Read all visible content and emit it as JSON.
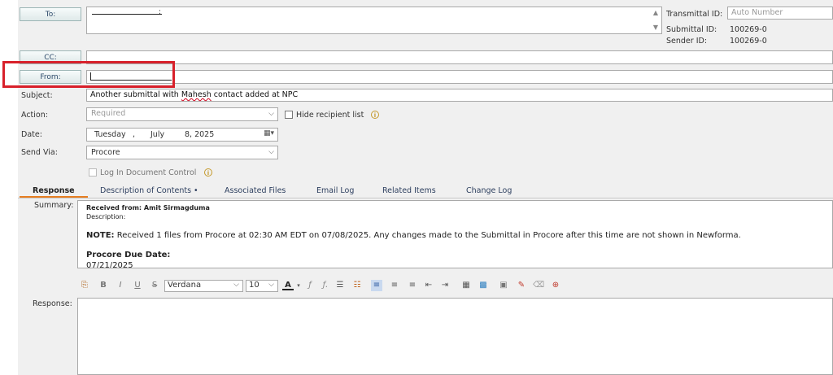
{
  "recipients": {
    "to_label": "To:",
    "cc_label": "CC:",
    "from_label": "From:"
  },
  "transmittal": {
    "transmittal_id_label": "Transmittal ID:",
    "transmittal_id_placeholder": "Auto Number",
    "submittal_id_label": "Submittal ID:",
    "submittal_id_value": "100269-0",
    "sender_id_label": "Sender ID:",
    "sender_id_value": "100269-0"
  },
  "form": {
    "subject_label": "Subject:",
    "subject_value_pre": "Another submittal with ",
    "subject_value_name": "Mahesh",
    "subject_value_post": " contact added at NPC",
    "action_label": "Action:",
    "action_placeholder": "Required",
    "hide_recipient_label": "Hide recipient list",
    "date_label": "Date:",
    "date_weekday": "Tuesday",
    "date_sep": ",",
    "date_month": "July",
    "date_day_year": "8, 2025",
    "sendvia_label": "Send Via:",
    "sendvia_value": "Procore",
    "log_label": "Log In Document Control"
  },
  "tabs": [
    {
      "label": "Response"
    },
    {
      "label": "Description of Contents •"
    },
    {
      "label": "Associated Files"
    },
    {
      "label": "Email Log"
    },
    {
      "label": "Related Items"
    },
    {
      "label": "Change Log"
    }
  ],
  "summary": {
    "label": "Summary:",
    "received_from": "Received from: Amit Sirmagduma",
    "description_label": "Description:",
    "note_bold": "NOTE:",
    "note_text": " Received 1 files from Procore at 02:30 AM EDT on 07/08/2025. Any changes made to the Submittal in Procore after this time are not shown in Newforma.",
    "due_heading": "Procore Due Date:",
    "due_value": "07/21/2025"
  },
  "editor": {
    "font_value": "Verdana",
    "size_value": "10",
    "response_label": "Response:"
  },
  "colors": {
    "highlight_red": "#d8202a",
    "tab_underline": "#e67e22"
  }
}
